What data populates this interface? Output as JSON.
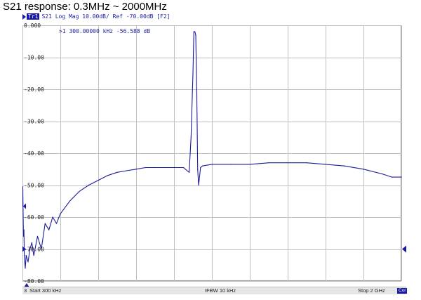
{
  "title": "S21 response: 0.3MHz ~ 2000MHz",
  "trace_header": {
    "tag": "Tr1",
    "text": "S21 Log Mag 10.00dB/ Ref -70.00dB [F2]"
  },
  "marker": {
    "number": "1",
    "readout": ">1  300.00000 kHz -56.588 dB"
  },
  "status_bar": {
    "channel": "3",
    "start": "Start 300 kHz",
    "ifbw": "IFBW 10 kHz",
    "stop": "Stop 2 GHz",
    "cor": "Cor"
  },
  "colors": {
    "trace": "#1a1aa0",
    "grid": "#c0c0c0",
    "background": "#ffffff"
  },
  "chart_data": {
    "type": "line",
    "title": "S21 response: 0.3MHz ~ 2000MHz",
    "xlabel": "",
    "ylabel": "",
    "xlim": [
      0.3,
      2000
    ],
    "x_unit": "MHz",
    "ylim": [
      -80,
      0
    ],
    "y_ticks": [
      0,
      -10,
      -20,
      -30,
      -40,
      -50,
      -60,
      -70,
      -80
    ],
    "y_tick_labels": [
      "0.000",
      "-10.00",
      "-20.00",
      "-30.00",
      "-40.00",
      "-50.00",
      "-60.00",
      "-70.00",
      "-80.00"
    ],
    "x_divisions": 10,
    "grid": true,
    "reference_level": -70,
    "series": [
      {
        "x": [
          0.3,
          2,
          4,
          6,
          8,
          10,
          15,
          20,
          30,
          40,
          50,
          60,
          80,
          100,
          120,
          140,
          160,
          180,
          200,
          250,
          300,
          350,
          400,
          450,
          500,
          550,
          600,
          650,
          700,
          750,
          800,
          850,
          880,
          890,
          900,
          905,
          910,
          915,
          920,
          925,
          930,
          940,
          950,
          1000,
          1100,
          1200,
          1300,
          1400,
          1500,
          1600,
          1700,
          1800,
          1900,
          1950,
          2000
        ],
        "y": [
          -56.6,
          -50.5,
          -60,
          -66,
          -64,
          -72,
          -76,
          -72,
          -74,
          -70,
          -68,
          -72,
          -66,
          -70,
          -62,
          -64,
          -60,
          -62,
          -59,
          -55,
          -52,
          -50,
          -48.5,
          -47,
          -46,
          -45.5,
          -45,
          -44.5,
          -44.5,
          -44.5,
          -44.5,
          -44.5,
          -46,
          -35,
          -15,
          -2,
          -2,
          -3,
          -20,
          -45,
          -50,
          -44.5,
          -44,
          -43.5,
          -43.5,
          -43.5,
          -43,
          -43,
          -43,
          -43.5,
          -44,
          -45,
          -46.5,
          -47.5,
          -47.5
        ]
      }
    ]
  }
}
